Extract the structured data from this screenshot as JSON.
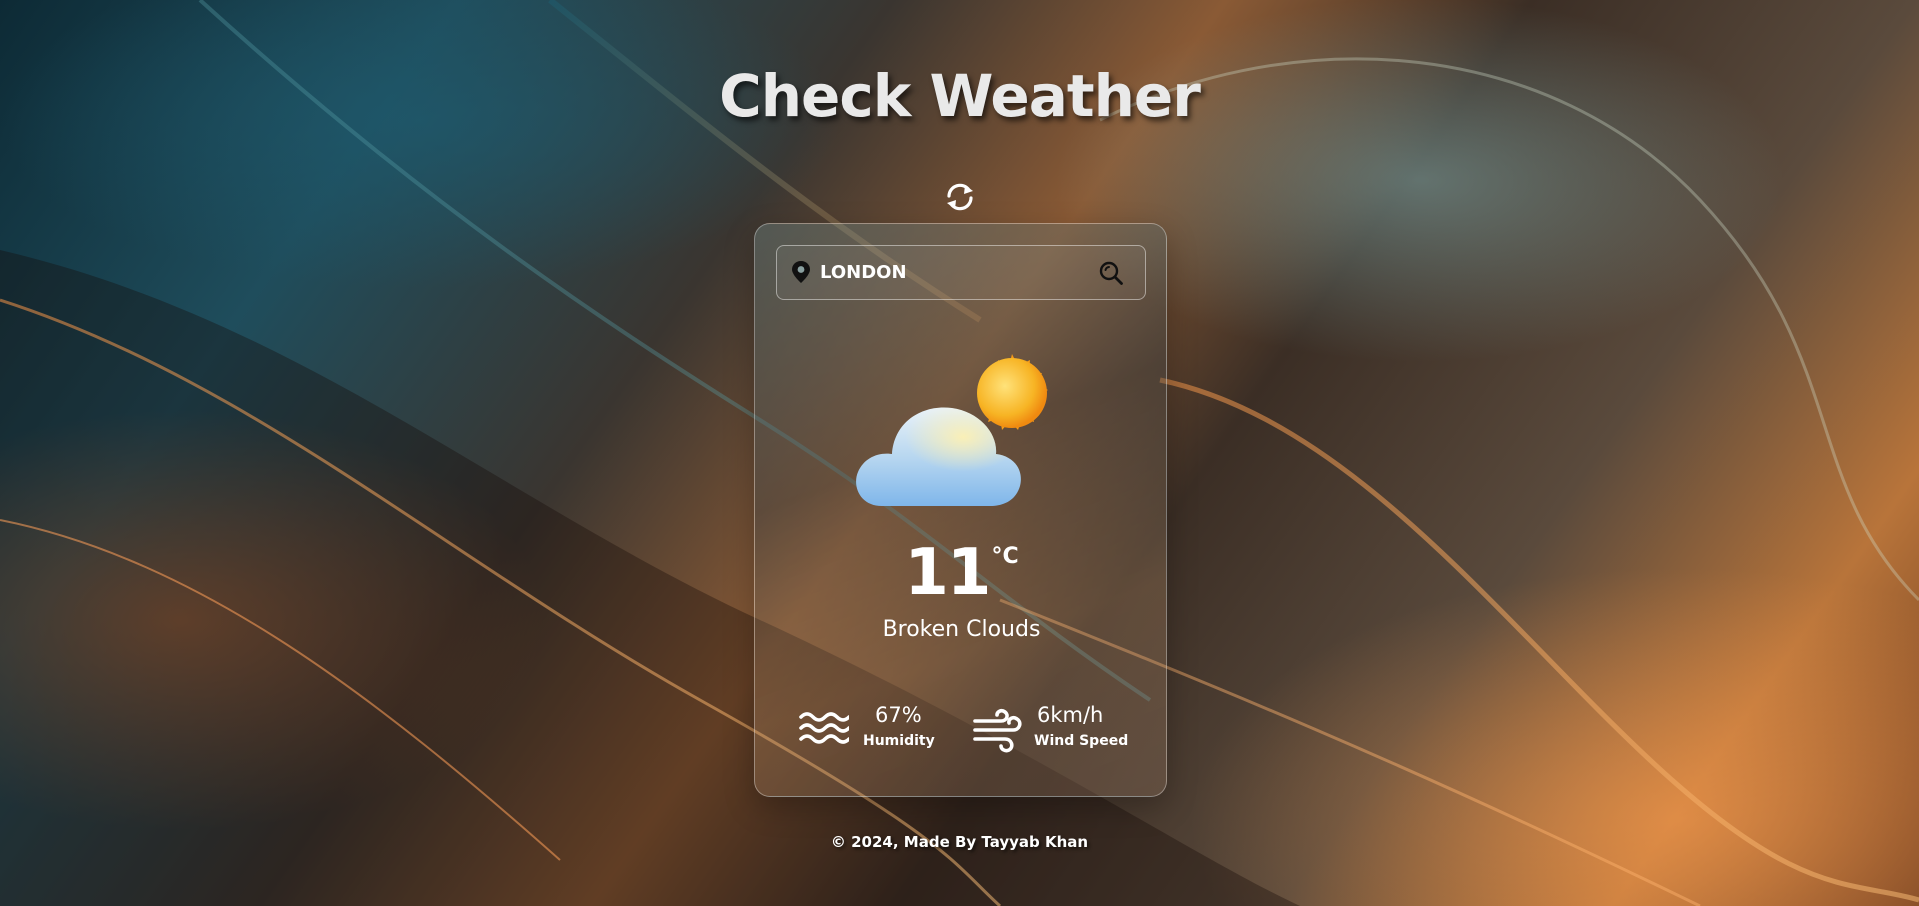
{
  "app": {
    "title": "Check Weather"
  },
  "search": {
    "value": "LONDON",
    "placeholder": "Enter city name"
  },
  "weather": {
    "temperature": "11",
    "unit": "°C",
    "description": "Broken Clouds",
    "icon": "cloud-sun-icon"
  },
  "stats": {
    "humidity": {
      "value": "67%",
      "label": "Humidity",
      "icon": "waves-icon"
    },
    "wind": {
      "value": "6km/h",
      "label": "Wind Speed",
      "icon": "wind-icon"
    }
  },
  "footer": {
    "text": "© 2024, Made By Tayyab Khan"
  },
  "colors": {
    "text": "#ffffff",
    "sun": "#f5a623",
    "cloud": "#8cc4f2"
  }
}
